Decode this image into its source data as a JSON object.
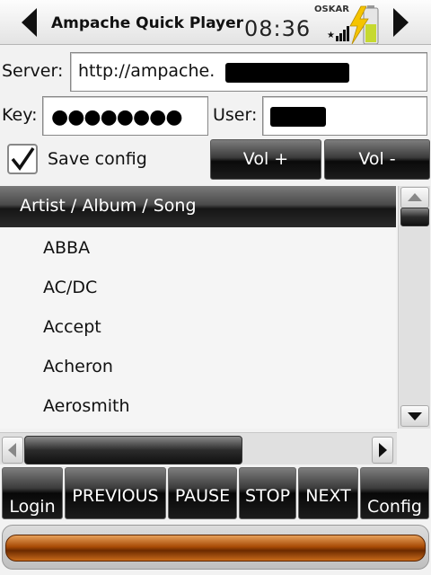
{
  "titlebar": {
    "title": "Ampache Quick Player",
    "time": "08:36",
    "operator": "OSKAR",
    "icons": [
      "arrow-left-icon",
      "signal-icon",
      "battery-charging-icon",
      "arrow-right-icon"
    ]
  },
  "form": {
    "server_label": "Server:",
    "server_value": "http://ampache.",
    "key_label": "Key:",
    "key_value": "●●●●●●●●",
    "user_label": "User:",
    "save_config_label": "Save config",
    "save_config_checked": true,
    "vol_up_label": "Vol +",
    "vol_down_label": "Vol -"
  },
  "list": {
    "header": "Artist / Album / Song",
    "items": [
      "ABBA",
      "AC/DC",
      "Accept",
      "Acheron",
      "Aerosmith"
    ]
  },
  "buttons": {
    "login": "Login",
    "previous": "PREVIOUS",
    "pause": "PAUSE",
    "stop": "STOP",
    "next": "NEXT",
    "config": "Config"
  },
  "progress": {
    "fraction": 1.0
  },
  "colors": {
    "accent": "#a84a05",
    "dark_button": "#1c1c1c"
  }
}
